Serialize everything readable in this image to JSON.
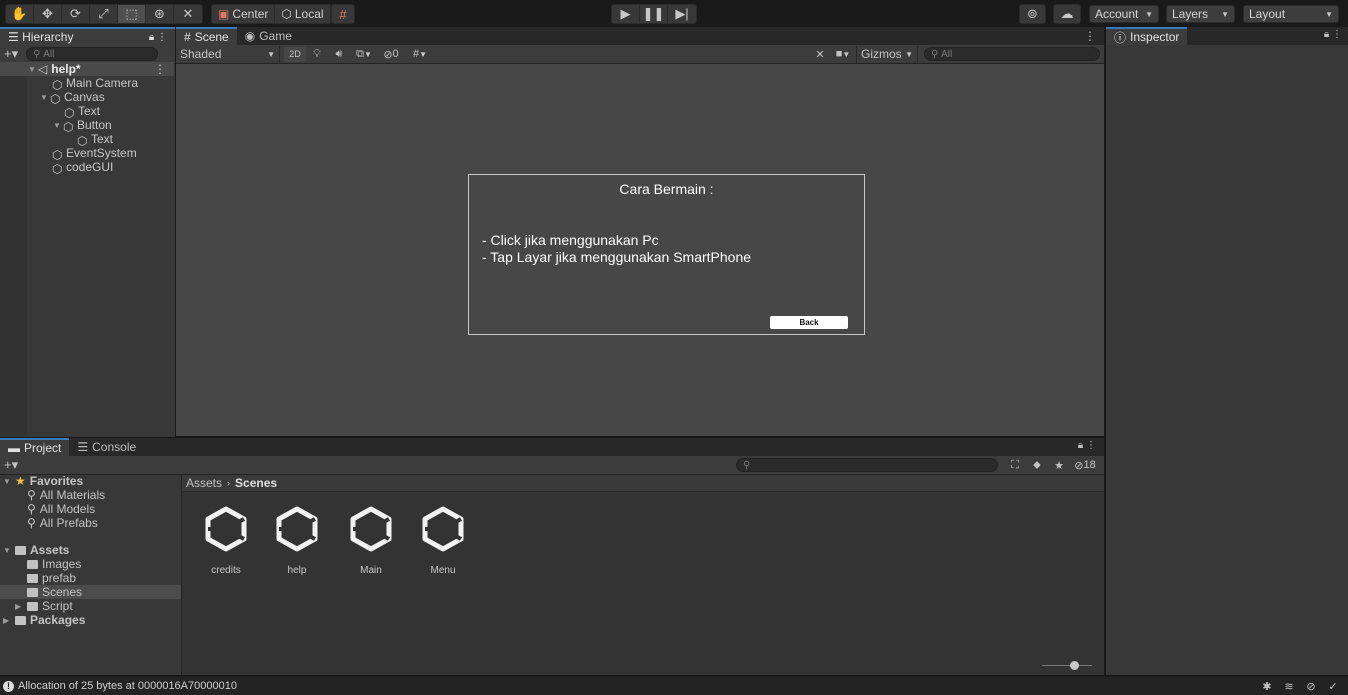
{
  "toolbar": {
    "tools": [
      "hand-tool-icon",
      "move-tool-icon",
      "rotate-tool-icon",
      "scale-tool-icon",
      "rect-tool-icon",
      "transform-tool-icon",
      "custom-tool-icon"
    ],
    "pivot_center": "Center",
    "pivot_local": "Local",
    "account_label": "Account",
    "layers_label": "Layers",
    "layout_label": "Layout"
  },
  "hierarchy": {
    "tab_label": "Hierarchy",
    "search_placeholder": "All",
    "scene_name": "help*",
    "items": [
      {
        "label": "Main Camera"
      },
      {
        "label": "Canvas"
      },
      {
        "label": "Text"
      },
      {
        "label": "Button"
      },
      {
        "label": "Text"
      },
      {
        "label": "EventSystem"
      },
      {
        "label": "codeGUI"
      }
    ]
  },
  "scene_view": {
    "tabs": [
      {
        "label": "Scene"
      },
      {
        "label": "Game"
      }
    ],
    "shading_mode": "Shaded",
    "mode_2d": "2D",
    "hidden_count": "0",
    "gizmos_label": "Gizmos",
    "search_placeholder": "All"
  },
  "game_ui": {
    "title": "Cara Bermain :",
    "line1": "- Click jika menggunakan Pc",
    "line2": "- Tap Layar jika menggunakan SmartPhone",
    "back_button": "Back"
  },
  "inspector": {
    "tab_label": "Inspector"
  },
  "project": {
    "tabs": [
      {
        "label": "Project"
      },
      {
        "label": "Console"
      }
    ],
    "hidden_count": "18",
    "favorites_label": "Favorites",
    "favorites": [
      {
        "label": "All Materials"
      },
      {
        "label": "All Models"
      },
      {
        "label": "All Prefabs"
      }
    ],
    "assets_label": "Assets",
    "asset_folders": [
      {
        "label": "Images"
      },
      {
        "label": "prefab"
      },
      {
        "label": "Scenes"
      },
      {
        "label": "Script"
      }
    ],
    "packages_label": "Packages",
    "breadcrumb_root": "Assets",
    "breadcrumb_current": "Scenes",
    "scenes": [
      {
        "label": "credits"
      },
      {
        "label": "help"
      },
      {
        "label": "Main"
      },
      {
        "label": "Menu"
      }
    ]
  },
  "status_bar": {
    "message": "Allocation of 25 bytes at 0000016A70000010"
  }
}
